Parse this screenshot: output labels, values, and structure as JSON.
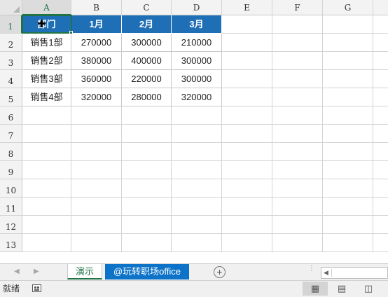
{
  "sheet": {
    "columns": [
      "A",
      "B",
      "C",
      "D",
      "E",
      "F",
      "G"
    ],
    "rows": [
      "1",
      "2",
      "3",
      "4",
      "5",
      "6",
      "7",
      "8",
      "9",
      "10",
      "11",
      "12",
      "13"
    ],
    "selected_cell": "A1",
    "header_row": [
      "部门",
      "1月",
      "2月",
      "3月"
    ],
    "data_rows": [
      [
        "销售1部",
        "270000",
        "300000",
        "210000"
      ],
      [
        "销售2部",
        "380000",
        "400000",
        "300000"
      ],
      [
        "销售3部",
        "360000",
        "220000",
        "300000"
      ],
      [
        "销售4部",
        "320000",
        "280000",
        "320000"
      ]
    ],
    "header_fill_color": "#1f6fb7"
  },
  "tabs": {
    "sheets": [
      "演示",
      "@玩转职场office"
    ],
    "active": "演示",
    "add_symbol": "+"
  },
  "status": {
    "ready_text": "就绪"
  },
  "icons": {
    "nav_prev": "triangle-left-icon",
    "nav_next": "triangle-right-icon",
    "add_sheet": "plus-circle-icon",
    "cursor": "move-crosshair-icon",
    "macro": "macro-record-icon",
    "normal_view": "normal-view-icon",
    "page_layout": "page-layout-icon",
    "page_break": "page-break-icon"
  },
  "colors": {
    "accent": "#217346",
    "tab_blue": "#0d73c9"
  }
}
